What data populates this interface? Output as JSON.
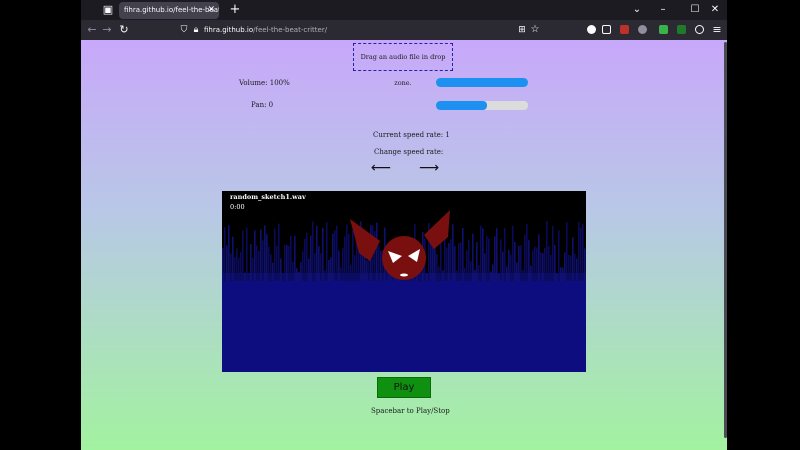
{
  "browser": {
    "tab_title": "fihra.github.io/feel-the-beat-critter/",
    "tab_close": "✕",
    "new_tab": "+",
    "url_host": "fihra.github.io",
    "url_path": "/feel-the-beat-critter/",
    "icons": [
      "tab-list-icon",
      "back-icon",
      "forward-icon",
      "reload-icon",
      "shield-icon",
      "lock-icon",
      "translate-icon",
      "star-icon",
      "extension-icon",
      "menu-icon"
    ]
  },
  "page": {
    "dropzone_text": "Drag an audio file in drop zone.",
    "volume_label": "Volume: 100%",
    "volume_level": 1.0,
    "pan_label": "Pan: 0",
    "pan_level": 0.55,
    "speed_label": "Current speed rate: 1",
    "change_speed_label": "Change speed rate:",
    "slower_arrow": "⟵",
    "faster_arrow": "⟶",
    "track_name": "random_sketch1.wav",
    "track_time": "0:00",
    "play_label": "Play",
    "hint": "Spacebar to Play/Stop"
  },
  "colors": {
    "gradient_top": "#c8a8fa",
    "gradient_bottom": "#a2f2a0",
    "slider_fill": "#1e90ef",
    "play_button": "#109010",
    "waveform": "#0d0d80",
    "critter": "#7a0f0f"
  }
}
